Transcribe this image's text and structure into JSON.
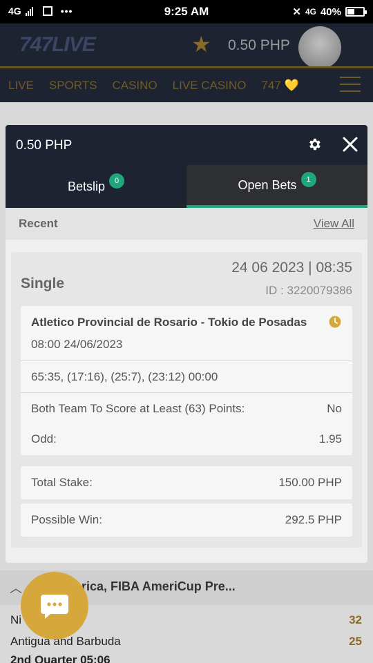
{
  "status_bar": {
    "network": "4G",
    "time": "9:25 AM",
    "network_right": "4G",
    "battery": "40%"
  },
  "header": {
    "logo": "747LIVE",
    "balance": "0.50 PHP"
  },
  "nav": {
    "items": [
      "LIVE",
      "SPORTS",
      "CASINO",
      "LIVE CASINO",
      "747 💛"
    ]
  },
  "modal": {
    "balance": "0.50 PHP",
    "tabs": [
      {
        "label": "Betslip",
        "count": "0"
      },
      {
        "label": "Open Bets",
        "count": "1"
      }
    ],
    "recent_label": "Recent",
    "view_all": "View All",
    "bet": {
      "type": "Single",
      "datetime": "24 06 2023 | 08:35",
      "id": "ID :  3220079386",
      "event": "Atletico Provincial de Rosario - Tokio de Posadas",
      "event_date": "08:00   24/06/2023",
      "score": "65:35, (17:16), (25:7), (23:12) 00:00",
      "market": "Both Team To Score at Least (63) Points:",
      "pick": "No",
      "odd_label": "Odd:",
      "odd_value": "1.95",
      "total_stake_label": "Total Stake:",
      "total_stake": "150.00 PHP",
      "possible_win_label": "Possible Win:",
      "possible_win": "292.5 PHP"
    }
  },
  "background_list": {
    "league": "rica, FIBA AmeriCup Pre...",
    "rows": [
      {
        "team": "Ni",
        "score": "32"
      },
      {
        "team": "Antigua and Barbuda",
        "score": "25"
      }
    ],
    "quarter": "2nd Quarter 05:06"
  },
  "colors": {
    "dark": "#1d2330",
    "accent_green": "#1fa67a",
    "gold": "#d6a73b"
  }
}
